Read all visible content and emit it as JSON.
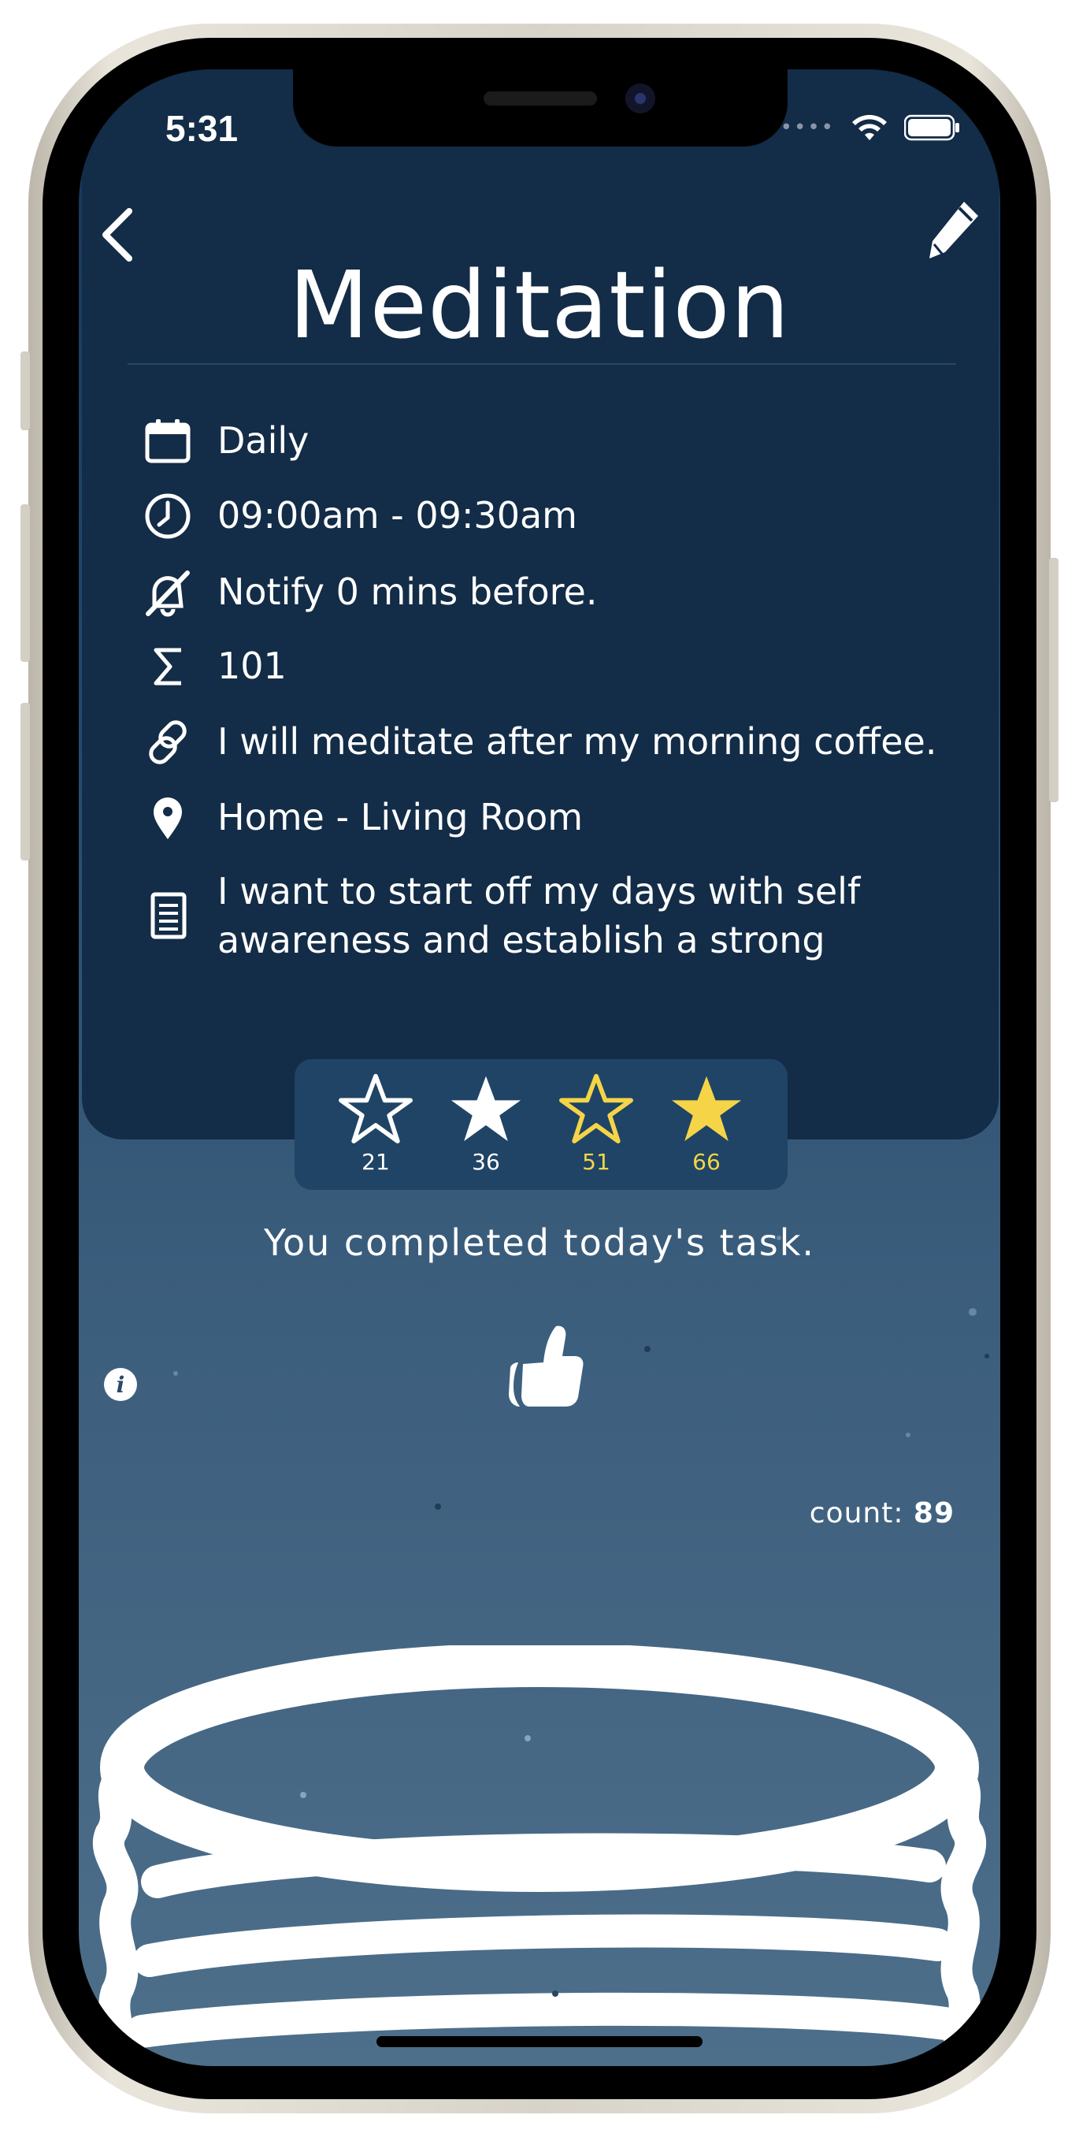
{
  "status_bar": {
    "time": "5:31"
  },
  "header": {
    "title": "Meditation"
  },
  "details": [
    {
      "icon": "calendar-icon",
      "text": "Daily"
    },
    {
      "icon": "clock-icon",
      "text": "09:00am - 09:30am"
    },
    {
      "icon": "bell-off-icon",
      "text": "Notify 0 mins before."
    },
    {
      "icon": "sigma-icon",
      "text": "101"
    },
    {
      "icon": "link-icon",
      "text": "I will meditate after my morning coffee."
    },
    {
      "icon": "location-pin-icon",
      "text": "Home - Living Room"
    },
    {
      "icon": "note-icon",
      "text": "I want to start off my days with self\nawareness and establish a strong"
    }
  ],
  "stars": [
    {
      "style": "outline",
      "color": "#ffffff",
      "label": "21"
    },
    {
      "style": "filled",
      "color": "#ffffff",
      "label": "36"
    },
    {
      "style": "outline",
      "color": "#f5d547",
      "label": "51"
    },
    {
      "style": "filled",
      "color": "#f5d547",
      "label": "66"
    }
  ],
  "completion": {
    "message": "You completed today's task."
  },
  "counter": {
    "label": "count: ",
    "value": "89"
  },
  "colors": {
    "card": "#132c47",
    "background_top": "#173556",
    "background_bottom": "#4d6f8a",
    "star_gold": "#f5d547",
    "text": "#ffffff"
  }
}
